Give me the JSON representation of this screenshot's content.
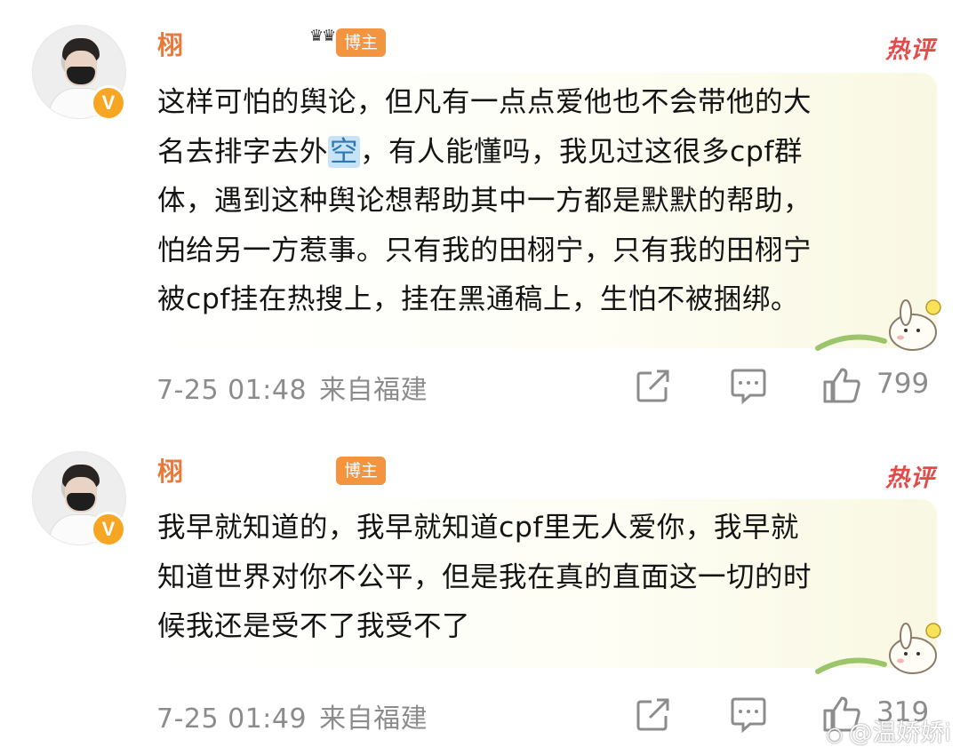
{
  "comments": [
    {
      "username": "栩",
      "badge": "博主",
      "hot_label": "热评",
      "text_lines": [
        "这样可怕的舆论，但凡有一点点爱他也不会带他的大",
        "名去排字去外",
        "，有人能懂吗，我见过这很多cpf群",
        "体，遇到这种舆论想帮助其中一方都是默默的帮助，",
        "怕给另一方惹事。只有我的田栩宁，只有我的田栩宁",
        "被cpf挂在热搜上，挂在黑通稿上，生怕不被捆绑。"
      ],
      "emoji": "空",
      "time": "7-25 01:48",
      "location": "来自福建",
      "likes": "799"
    },
    {
      "username": "栩",
      "badge": "博主",
      "hot_label": "热评",
      "text_lines": [
        "我早就知道的，我早就知道cpf里无人爱你，我早就",
        "知道世界对你不公平，但是我在真的直面这一切的时",
        "候我还是受不了我受不了"
      ],
      "time": "7-25 01:49",
      "location": "来自福建",
      "likes": "319"
    }
  ],
  "watermark": {
    "icon": "weibo-icon",
    "text": "@温娇娇i"
  },
  "colors": {
    "username": "#e8793a",
    "badge": "#f39441",
    "hot": "#e34a4a",
    "meta": "#8c8c8c"
  }
}
